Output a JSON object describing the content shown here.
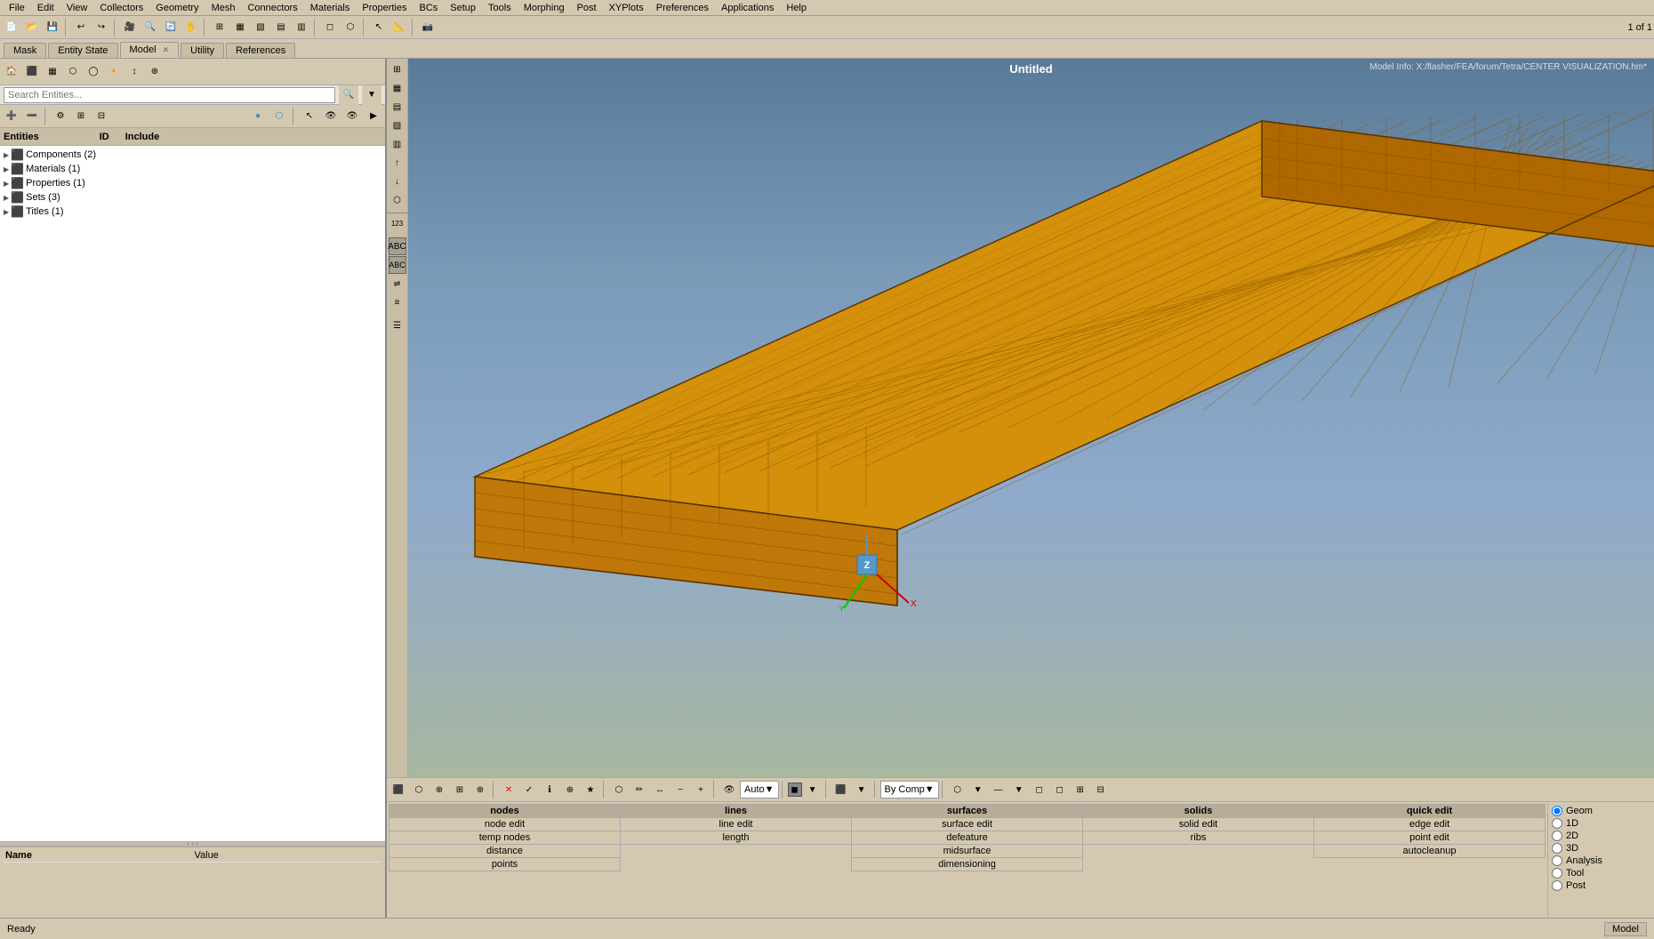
{
  "menubar": {
    "items": [
      "File",
      "Edit",
      "View",
      "Collectors",
      "Geometry",
      "Mesh",
      "Connectors",
      "Materials",
      "Properties",
      "BCs",
      "Setup",
      "Tools",
      "Morphing",
      "Post",
      "XYPlots",
      "Preferences",
      "Applications",
      "Help"
    ]
  },
  "tabs": {
    "items": [
      {
        "label": "Mask",
        "active": false,
        "closable": false
      },
      {
        "label": "Entity State",
        "active": false,
        "closable": false
      },
      {
        "label": "Model",
        "active": true,
        "closable": true
      },
      {
        "label": "Utility",
        "active": false,
        "closable": false
      },
      {
        "label": "References",
        "active": false,
        "closable": false
      }
    ]
  },
  "search": {
    "placeholder": "Search Entities..."
  },
  "entities": {
    "header_label": "Entities",
    "id_label": "ID",
    "include_label": "Include",
    "items": [
      {
        "label": "Components (2)",
        "level": 1,
        "icon": "▶"
      },
      {
        "label": "Materials (1)",
        "level": 1,
        "icon": "▶"
      },
      {
        "label": "Properties (1)",
        "level": 1,
        "icon": "▶"
      },
      {
        "label": "Sets (3)",
        "level": 1,
        "icon": "▶"
      },
      {
        "label": "Titles (1)",
        "level": 1,
        "icon": "▶"
      }
    ]
  },
  "bottom_left": {
    "name_label": "Name",
    "value_label": "Value"
  },
  "viewport": {
    "title": "Untitled",
    "model_info": "Model Info: X:/flasher/FEA/forum/Tetra/CENTER VISUALIZATION.hm*"
  },
  "bottom_table": {
    "columns": [
      "nodes",
      "lines",
      "surfaces",
      "solids",
      "quick edit"
    ],
    "rows": [
      [
        "node edit",
        "line edit",
        "surface edit",
        "solid edit",
        "edge edit"
      ],
      [
        "temp nodes",
        "length",
        "defeature",
        "ribs",
        "point edit"
      ],
      [
        "distance",
        "",
        "midsurface",
        "",
        "autocleanup"
      ],
      [
        "points",
        "",
        "dimensioning",
        "",
        ""
      ]
    ]
  },
  "radio_panel": {
    "items": [
      {
        "label": "Geom",
        "name": "mode",
        "value": "geom",
        "checked": true
      },
      {
        "label": "1D",
        "name": "mode",
        "value": "1d",
        "checked": false
      },
      {
        "label": "2D",
        "name": "mode",
        "value": "2d",
        "checked": false
      },
      {
        "label": "3D",
        "name": "mode",
        "value": "3d",
        "checked": false
      },
      {
        "label": "Analysis",
        "name": "mode",
        "value": "analysis",
        "checked": false
      },
      {
        "label": "Tool",
        "name": "mode",
        "value": "tool",
        "checked": false
      },
      {
        "label": "Post",
        "name": "mode",
        "value": "post",
        "checked": false
      }
    ]
  },
  "statusbar": {
    "left_text": "Ready",
    "model_label": "Model"
  },
  "bottom_toolbar": {
    "auto_label": "Auto",
    "bycomp_label": "By Comp"
  }
}
